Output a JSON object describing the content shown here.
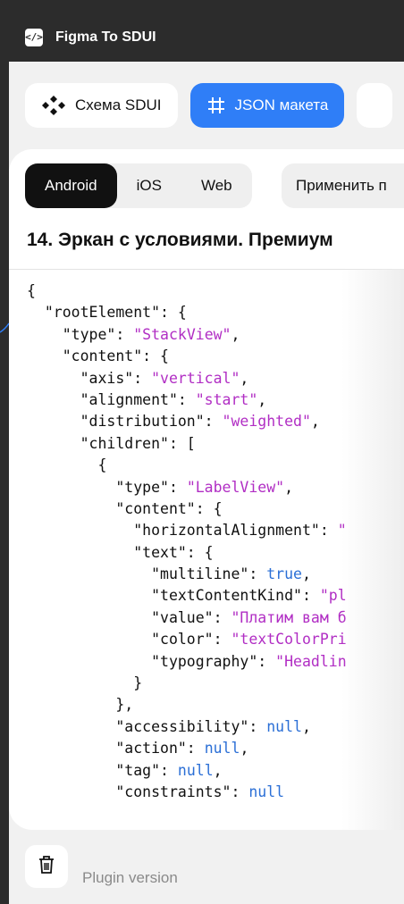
{
  "window": {
    "icon": "code-icon",
    "icon_glyph": "</>",
    "title": "Figma To SDUI"
  },
  "tabs": {
    "scheme": {
      "label": "Схема SDUI",
      "icon": "components-icon"
    },
    "json": {
      "label": "JSON макета",
      "icon": "hash-icon"
    }
  },
  "platforms": {
    "items": [
      "Android",
      "iOS",
      "Web"
    ],
    "selected": "Android"
  },
  "apply_label": "Применить п",
  "screen_title": "14. Эркан с условиями. Премиум",
  "code_lines": [
    [
      {
        "t": "{",
        "c": "p"
      }
    ],
    [
      {
        "t": "  \"rootElement\": {",
        "c": "p"
      }
    ],
    [
      {
        "t": "    \"type\": ",
        "c": "p"
      },
      {
        "t": "\"StackView\"",
        "c": "s"
      },
      {
        "t": ",",
        "c": "p"
      }
    ],
    [
      {
        "t": "    \"content\": {",
        "c": "p"
      }
    ],
    [
      {
        "t": "      \"axis\": ",
        "c": "p"
      },
      {
        "t": "\"vertical\"",
        "c": "s"
      },
      {
        "t": ",",
        "c": "p"
      }
    ],
    [
      {
        "t": "      \"alignment\": ",
        "c": "p"
      },
      {
        "t": "\"start\"",
        "c": "s"
      },
      {
        "t": ",",
        "c": "p"
      }
    ],
    [
      {
        "t": "      \"distribution\": ",
        "c": "p"
      },
      {
        "t": "\"weighted\"",
        "c": "s"
      },
      {
        "t": ",",
        "c": "p"
      }
    ],
    [
      {
        "t": "      \"children\": [",
        "c": "p"
      }
    ],
    [
      {
        "t": "        {",
        "c": "p"
      }
    ],
    [
      {
        "t": "          \"type\": ",
        "c": "p"
      },
      {
        "t": "\"LabelView\"",
        "c": "s"
      },
      {
        "t": ",",
        "c": "p"
      }
    ],
    [
      {
        "t": "          \"content\": {",
        "c": "p"
      }
    ],
    [
      {
        "t": "            \"horizontalAlignment\": ",
        "c": "p"
      },
      {
        "t": "\"",
        "c": "s"
      }
    ],
    [
      {
        "t": "            \"text\": {",
        "c": "p"
      }
    ],
    [
      {
        "t": "              \"multiline\": ",
        "c": "p"
      },
      {
        "t": "true",
        "c": "k"
      },
      {
        "t": ",",
        "c": "p"
      }
    ],
    [
      {
        "t": "              \"textContentKind\": ",
        "c": "p"
      },
      {
        "t": "\"pl",
        "c": "s"
      }
    ],
    [
      {
        "t": "              \"value\": ",
        "c": "p"
      },
      {
        "t": "\"Платим вам б",
        "c": "s"
      }
    ],
    [
      {
        "t": "              \"color\": ",
        "c": "p"
      },
      {
        "t": "\"textColorPri",
        "c": "s"
      }
    ],
    [
      {
        "t": "              \"typography\": ",
        "c": "p"
      },
      {
        "t": "\"Headlin",
        "c": "s"
      }
    ],
    [
      {
        "t": "            }",
        "c": "p"
      }
    ],
    [
      {
        "t": "          },",
        "c": "p"
      }
    ],
    [
      {
        "t": "          \"accessibility\": ",
        "c": "p"
      },
      {
        "t": "null",
        "c": "k"
      },
      {
        "t": ",",
        "c": "p"
      }
    ],
    [
      {
        "t": "          \"action\": ",
        "c": "p"
      },
      {
        "t": "null",
        "c": "k"
      },
      {
        "t": ",",
        "c": "p"
      }
    ],
    [
      {
        "t": "          \"tag\": ",
        "c": "p"
      },
      {
        "t": "null",
        "c": "k"
      },
      {
        "t": ",",
        "c": "p"
      }
    ],
    [
      {
        "t": "          \"constraints\": ",
        "c": "p"
      },
      {
        "t": "null",
        "c": "k"
      }
    ]
  ],
  "footer": {
    "trash_icon": "trash-icon",
    "plugin_version": "Plugin version"
  },
  "colors": {
    "accent": "#2f7ef7",
    "string": "#b12ec4",
    "keyword": "#2b6fd6",
    "titlebar": "#2c2c2c"
  }
}
